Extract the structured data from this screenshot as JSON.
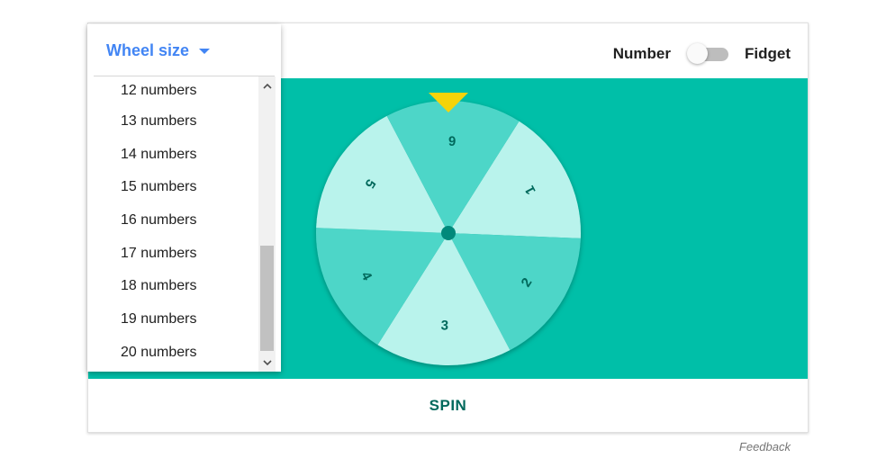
{
  "toggle": {
    "left_label": "Number",
    "right_label": "Fidget",
    "state": "off"
  },
  "wheel_size_menu": {
    "title": "Wheel size",
    "options": [
      "12 numbers",
      "13 numbers",
      "14 numbers",
      "15 numbers",
      "16 numbers",
      "17 numbers",
      "18 numbers",
      "19 numbers",
      "20 numbers"
    ]
  },
  "wheel": {
    "segments": [
      "1",
      "2",
      "3",
      "4",
      "5",
      "6"
    ],
    "colors": {
      "background": "#00bfa8",
      "segment_dark": "#4dd6c8",
      "segment_light": "#b9f3ec",
      "label": "#00695c",
      "hub": "#00897b",
      "pointer": "#f6d30a"
    }
  },
  "footer": {
    "spin_label": "SPIN"
  },
  "feedback_label": "Feedback"
}
